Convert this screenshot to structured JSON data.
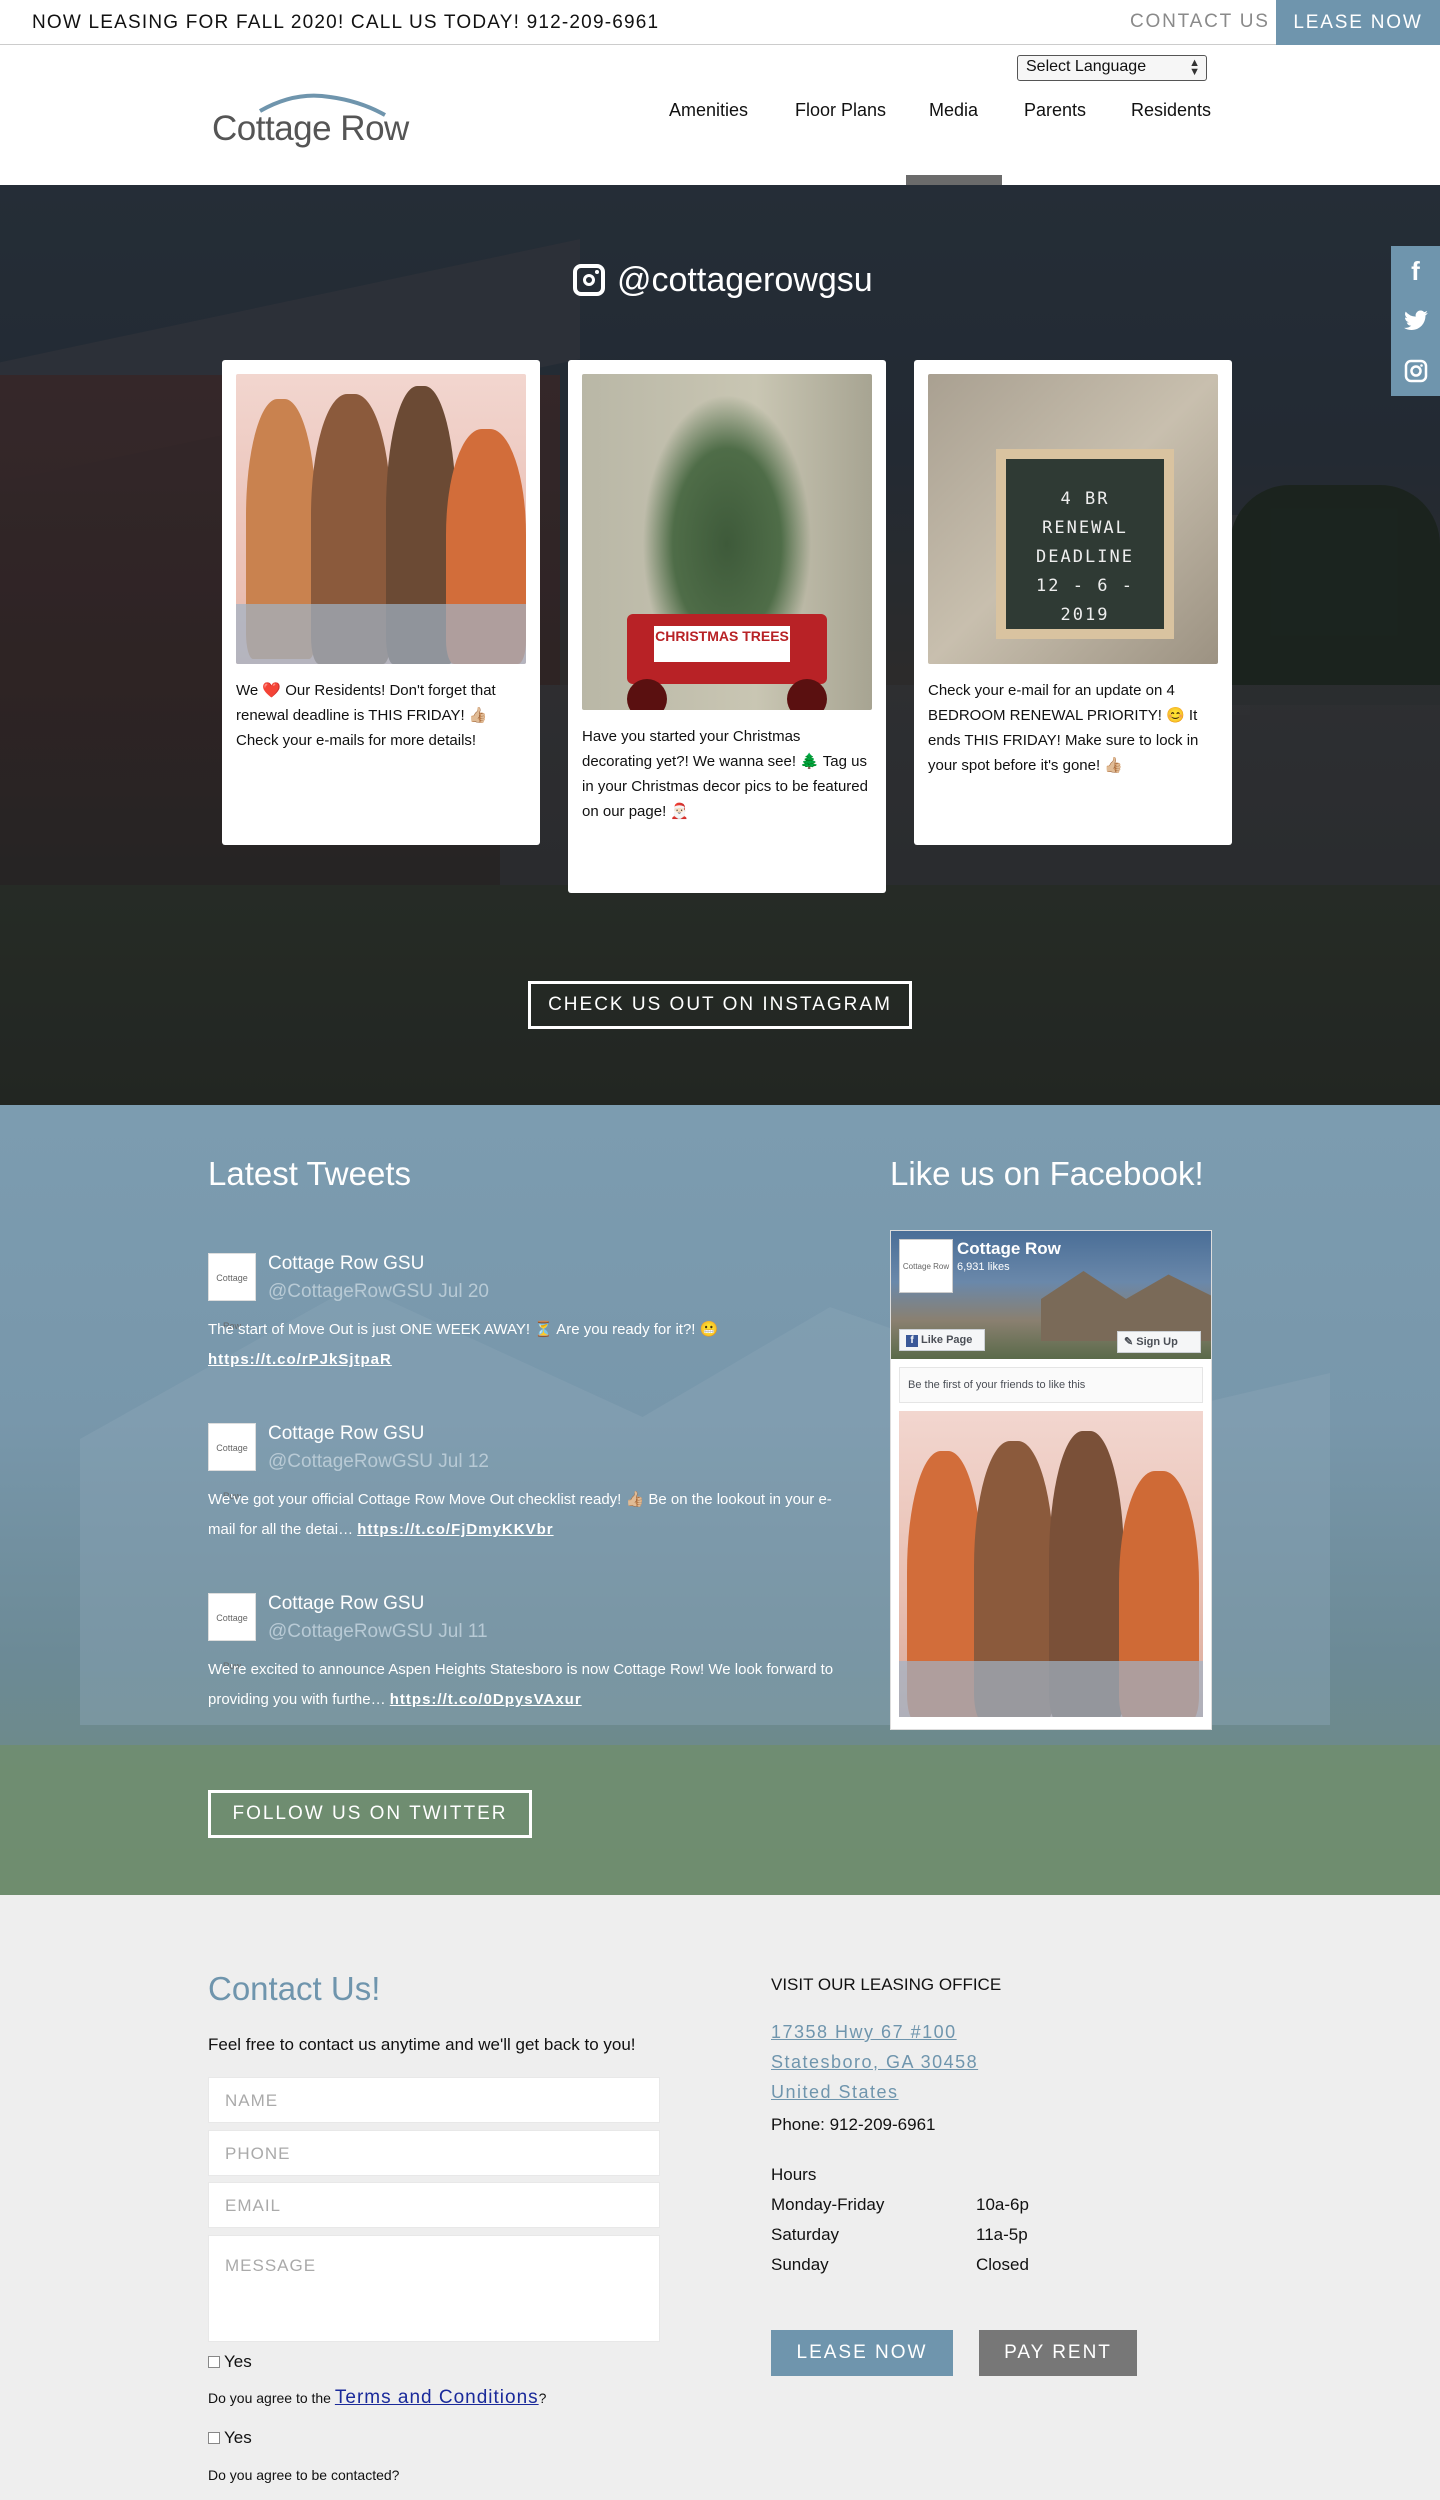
{
  "topbar": {
    "announcement": "NOW LEASING FOR FALL 2020! CALL US TODAY! 912-209-6961",
    "contact_link": "CONTACT US",
    "lease_button": "LEASE NOW"
  },
  "header": {
    "language_select": "Select Language",
    "logo_text": "Cottage Row",
    "nav": [
      {
        "label": "Amenities"
      },
      {
        "label": "Floor Plans"
      },
      {
        "label": "Media"
      },
      {
        "label": "Parents"
      },
      {
        "label": "Residents"
      }
    ],
    "active_nav": "Media"
  },
  "instagram": {
    "handle": "@cottagerowgsu",
    "posts": [
      {
        "caption": "We ❤️ Our Residents! Don't forget that renewal deadline is THIS FRIDAY! 👍🏼 Check your e-mails for more details!"
      },
      {
        "caption": "Have you started your Christmas decorating yet?! We wanna see! 🌲 Tag us in your Christmas decor pics to be featured on our page! 🎅🏻",
        "sign_text": "CHRISTMAS TREES"
      },
      {
        "caption": "Check your e-mail for an update on 4 BEDROOM RENEWAL PRIORITY! 😊 It ends THIS FRIDAY! Make sure to lock in your spot before it's gone! 👍🏼",
        "letterboard": [
          "4 BR",
          "RENEWAL",
          "DEADLINE",
          "12 - 6 - 2019"
        ]
      }
    ],
    "cta": "CHECK US OUT ON INSTAGRAM"
  },
  "social": [
    {
      "icon": "facebook-icon",
      "glyph": "f"
    },
    {
      "icon": "twitter-icon",
      "glyph": "t"
    },
    {
      "icon": "instagram-icon",
      "glyph": "◎"
    }
  ],
  "tweets": {
    "title": "Latest Tweets",
    "items": [
      {
        "name": "Cottage Row GSU",
        "handle_date": "@CottageRowGSU Jul 20",
        "text": "The start of Move Out is just ONE WEEK AWAY! ⏳ Are you ready for it?! 😬",
        "link": "https://t.co/rPJkSjtpaR"
      },
      {
        "name": "Cottage Row GSU",
        "handle_date": "@CottageRowGSU Jul 12",
        "text": "We've got your official Cottage Row Move Out checklist ready! 👍🏼 Be on the lookout in your e-mail for all the detai…",
        "link": "https://t.co/FjDmyKKVbr"
      },
      {
        "name": "Cottage Row GSU",
        "handle_date": "@CottageRowGSU Jul 11",
        "text": "We're excited to announce Aspen Heights Statesboro is now Cottage Row! We look forward to providing you with furthe…",
        "link": "https://t.co/0DpysVAxur"
      }
    ],
    "cta": "FOLLOW US ON TWITTER"
  },
  "facebook": {
    "title": "Like us on Facebook!",
    "page_name": "Cottage Row",
    "likes": "6,931 likes",
    "like_button": "Like Page",
    "signup_button": "Sign Up",
    "friends_text": "Be the first of your friends to like this",
    "avatar_text": "Cottage Row"
  },
  "contact": {
    "title": "Contact Us!",
    "subtitle": "Feel free to contact us anytime and we'll get back to you!",
    "fields": {
      "name": "NAME",
      "phone": "PHONE",
      "email": "EMAIL",
      "message": "MESSAGE"
    },
    "yes_label": "Yes",
    "terms_prefix": "Do you agree to the ",
    "terms_link": "Terms and Conditions",
    "terms_suffix": "?",
    "contact_agree": "Do you agree to be contacted?"
  },
  "office": {
    "title": "VISIT OUR LEASING OFFICE",
    "address": [
      "17358 Hwy 67 #100",
      "Statesboro, GA 30458",
      "United States"
    ],
    "phone": "Phone: 912-209-6961",
    "hours_title": "Hours",
    "hours": [
      {
        "day": "Monday-Friday",
        "time": "10a-6p"
      },
      {
        "day": "Saturday",
        "time": "11a-5p"
      },
      {
        "day": "Sunday",
        "time": "Closed"
      }
    ],
    "lease_button": "LEASE NOW",
    "pay_button": "PAY RENT"
  },
  "colors": {
    "accent": "#6f95ad",
    "pay_button": "#777777",
    "link_blue": "#1a2a9a"
  }
}
